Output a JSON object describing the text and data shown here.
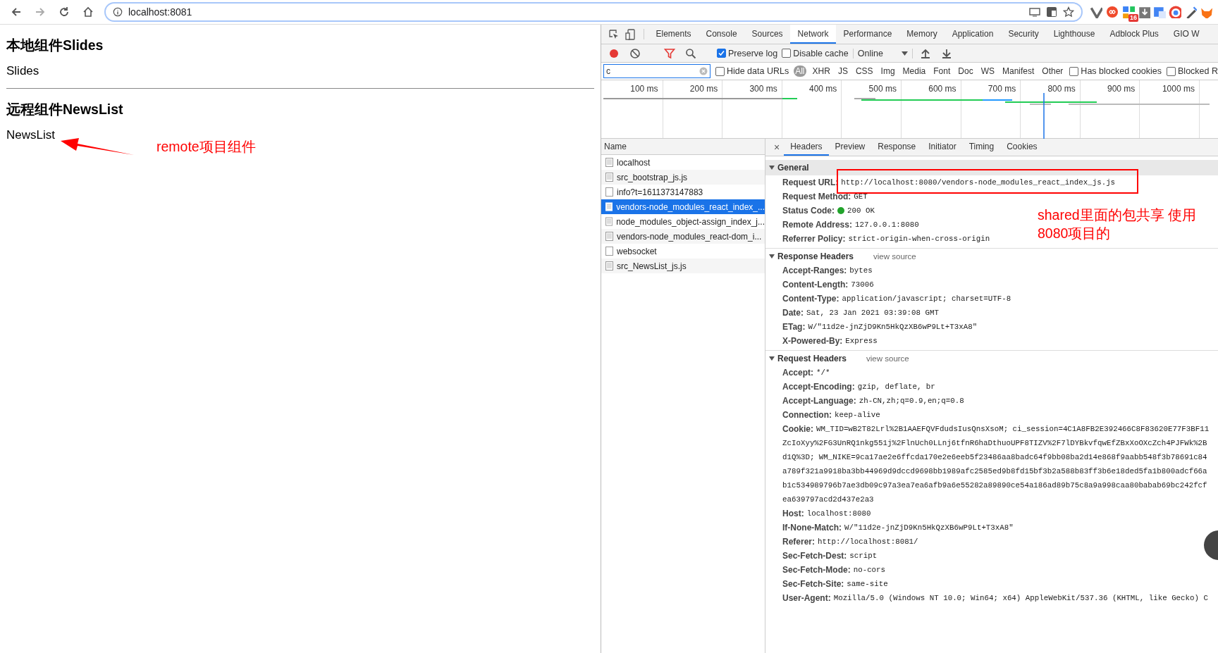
{
  "browser": {
    "url": "localhost:8081",
    "forward_disabled": true,
    "extension_badge": "16"
  },
  "page": {
    "local_heading": "本地组件Slides",
    "local_text": "Slides",
    "remote_heading": "远程组件NewsList",
    "remote_text": "NewsList"
  },
  "annotations": [
    {
      "kind": "arrow-note",
      "text": "remote项目组件"
    },
    {
      "kind": "box-note",
      "lines": [
        "shared里面的包共享 使用",
        "8080项目的"
      ]
    }
  ],
  "devtools": {
    "tabs": [
      {
        "label": "Elements",
        "selected": false
      },
      {
        "label": "Console",
        "selected": false
      },
      {
        "label": "Sources",
        "selected": false
      },
      {
        "label": "Network",
        "selected": true
      },
      {
        "label": "Performance",
        "selected": false
      },
      {
        "label": "Memory",
        "selected": false
      },
      {
        "label": "Application",
        "selected": false
      },
      {
        "label": "Security",
        "selected": false
      },
      {
        "label": "Lighthouse",
        "selected": false
      },
      {
        "label": "Adblock Plus",
        "selected": false
      },
      {
        "label": "GIO W",
        "selected": false
      }
    ],
    "toolbar": {
      "recording": true,
      "preserve_log": {
        "label": "Preserve log",
        "checked": true
      },
      "disable_cache": {
        "label": "Disable cache",
        "checked": false
      },
      "throttling": "Online"
    },
    "filter": {
      "value": "c",
      "hide_data_urls": {
        "label": "Hide data URLs",
        "checked": false
      },
      "types": [
        {
          "label": "All",
          "selected": true
        },
        {
          "label": "XHR",
          "selected": false
        },
        {
          "label": "JS",
          "selected": false
        },
        {
          "label": "CSS",
          "selected": false
        },
        {
          "label": "Img",
          "selected": false
        },
        {
          "label": "Media",
          "selected": false
        },
        {
          "label": "Font",
          "selected": false
        },
        {
          "label": "Doc",
          "selected": false
        },
        {
          "label": "WS",
          "selected": false
        },
        {
          "label": "Manifest",
          "selected": false
        },
        {
          "label": "Other",
          "selected": false
        }
      ],
      "has_blocked_cookies": {
        "label": "Has blocked cookies",
        "checked": false
      },
      "blocked": {
        "label": "Blocked R",
        "checked": false
      }
    },
    "timeline_ticks": [
      "100 ms",
      "200 ms",
      "300 ms",
      "400 ms",
      "500 ms",
      "600 ms",
      "700 ms",
      "800 ms",
      "900 ms",
      "1000 ms"
    ],
    "requests_header": "Name",
    "requests": [
      {
        "name": "localhost",
        "kind": "document",
        "selected": false
      },
      {
        "name": "src_bootstrap_js.js",
        "kind": "document",
        "selected": false
      },
      {
        "name": "info?t=1611373147883",
        "kind": "blank",
        "selected": false
      },
      {
        "name": "vendors-node_modules_react_index_...",
        "kind": "document",
        "selected": true
      },
      {
        "name": "node_modules_object-assign_index_j...",
        "kind": "document",
        "selected": false
      },
      {
        "name": "vendors-node_modules_react-dom_i...",
        "kind": "document",
        "selected": false
      },
      {
        "name": "websocket",
        "kind": "blank",
        "selected": false
      },
      {
        "name": "src_NewsList_js.js",
        "kind": "document",
        "selected": false
      }
    ],
    "close_glyph": "×",
    "detail_tabs": [
      {
        "label": "Headers",
        "selected": true
      },
      {
        "label": "Preview",
        "selected": false
      },
      {
        "label": "Response",
        "selected": false
      },
      {
        "label": "Initiator",
        "selected": false
      },
      {
        "label": "Timing",
        "selected": false
      },
      {
        "label": "Cookies",
        "selected": false
      }
    ],
    "sections": [
      {
        "title": "General",
        "expanded": true,
        "selected": true,
        "rows": [
          {
            "name": "Request URL:",
            "value": "http://localhost:8080/vendors-node_modules_react_index_js.js",
            "kind": "plain"
          },
          {
            "name": "Request Method:",
            "value": "GET",
            "kind": "plain"
          },
          {
            "name": "Status Code:",
            "value": "200 OK",
            "kind": "status"
          },
          {
            "name": "Remote Address:",
            "value": "127.0.0.1:8080",
            "kind": "plain"
          },
          {
            "name": "Referrer Policy:",
            "value": "strict-origin-when-cross-origin",
            "kind": "plain"
          }
        ]
      },
      {
        "title": "Response Headers",
        "view_source": "view source",
        "expanded": true,
        "selected": false,
        "rows": [
          {
            "name": "Accept-Ranges:",
            "value": "bytes",
            "kind": "plain"
          },
          {
            "name": "Content-Length:",
            "value": "73006",
            "kind": "plain"
          },
          {
            "name": "Content-Type:",
            "value": "application/javascript; charset=UTF-8",
            "kind": "plain"
          },
          {
            "name": "Date:",
            "value": "Sat, 23 Jan 2021 03:39:08 GMT",
            "kind": "plain"
          },
          {
            "name": "ETag:",
            "value": "W/\"11d2e-jnZjD9Kn5HkQzXB6wP9Lt+T3xA8\"",
            "kind": "plain"
          },
          {
            "name": "X-Powered-By:",
            "value": "Express",
            "kind": "plain"
          }
        ]
      },
      {
        "title": "Request Headers",
        "view_source": "view source",
        "expanded": true,
        "selected": false,
        "rows": [
          {
            "name": "Accept:",
            "value": "*/*",
            "kind": "plain"
          },
          {
            "name": "Accept-Encoding:",
            "value": "gzip, deflate, br",
            "kind": "plain"
          },
          {
            "name": "Accept-Language:",
            "value": "zh-CN,zh;q=0.9,en;q=0.8",
            "kind": "plain"
          },
          {
            "name": "Connection:",
            "value": "keep-alive",
            "kind": "plain"
          },
          {
            "name": "Cookie:",
            "value": "WM_TID=wB2T82Lrl%2B1AAEFQVFdudsIusQnsXsoM; ci_session=4C1A8FB2E392466C8F83620E77F3BF11",
            "kind": "plain"
          },
          {
            "value": "ZcIoXyy%2FG3UnRQ1nkg551j%2FlnUch0LLnj6tfnR6haDthuoUPF8TIZV%2F7lDYBkvfqwEfZBxXoOXcZch4PJFWk%2B",
            "kind": "continuation"
          },
          {
            "value": "d1Q%3D; WM_NIKE=9ca17ae2e6ffcda170e2e6eeb5f23486aa8badc64f9bb08ba2d14e868f9aabb548f3b78691c84",
            "kind": "continuation"
          },
          {
            "value": "a789f321a9918ba3bb44969d9dccd9698bb1989afc2585ed9b8fd15bf3b2a588b83ff3b6e18ded5fa1b800adcf66a",
            "kind": "continuation"
          },
          {
            "value": "b1c534989796b7ae3db09c97a3ea7ea6afb9a6e55282a89890ce54a186ad89b75c8a9a998caa80babab69bc242fcf",
            "kind": "continuation"
          },
          {
            "value": "ea639797acd2d437e2a3",
            "kind": "continuation"
          },
          {
            "name": "Host:",
            "value": "localhost:8080",
            "kind": "plain"
          },
          {
            "name": "If-None-Match:",
            "value": "W/\"11d2e-jnZjD9Kn5HkQzXB6wP9Lt+T3xA8\"",
            "kind": "plain"
          },
          {
            "name": "Referer:",
            "value": "http://localhost:8081/",
            "kind": "plain"
          },
          {
            "name": "Sec-Fetch-Dest:",
            "value": "script",
            "kind": "plain"
          },
          {
            "name": "Sec-Fetch-Mode:",
            "value": "no-cors",
            "kind": "plain"
          },
          {
            "name": "Sec-Fetch-Site:",
            "value": "same-site",
            "kind": "plain"
          },
          {
            "name": "User-Agent:",
            "value": "Mozilla/5.0 (Windows NT 10.0; Win64; x64) AppleWebKit/537.36 (KHTML, like Gecko) C",
            "kind": "plain"
          }
        ]
      }
    ]
  }
}
